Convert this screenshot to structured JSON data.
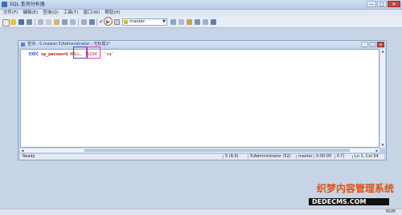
{
  "titlebar": {
    "title": "SQL 查询分析器",
    "min": "—",
    "max": "□",
    "close": "✕"
  },
  "menu": [
    "文件(F)",
    "编辑(E)",
    "查询(Q)",
    "工具(T)",
    "窗口(W)",
    "帮助(H)"
  ],
  "toolbar": {
    "database": "master"
  },
  "child": {
    "title": "查询 - 5.master.5\\Administrator - 无标题1*",
    "min": "_",
    "max": "□",
    "close": "x"
  },
  "editor": {
    "keyword": "EXEC",
    "procedure": "sp_password",
    "null_arg": "NULL,",
    "old_pwd": "'1234'",
    "new_pwd": "'sa'"
  },
  "status": {
    "ready": "Ready",
    "server": "5 (8.0)",
    "user": "5\\Administrator (52)",
    "database": "master",
    "time": "0:00:00",
    "rows": "0 行",
    "position": "Ln 1, Col 34"
  },
  "mainstatus": {
    "left": "",
    "right": "NUM"
  },
  "watermark": {
    "cn": "织梦内容管理系统",
    "url": "DEDECMS.COM"
  },
  "colors": {
    "keyword": "#1b3fd6",
    "procedure": "#b01010",
    "highlight_blue": "#3355dd",
    "highlight_pink": "#e040c0"
  }
}
